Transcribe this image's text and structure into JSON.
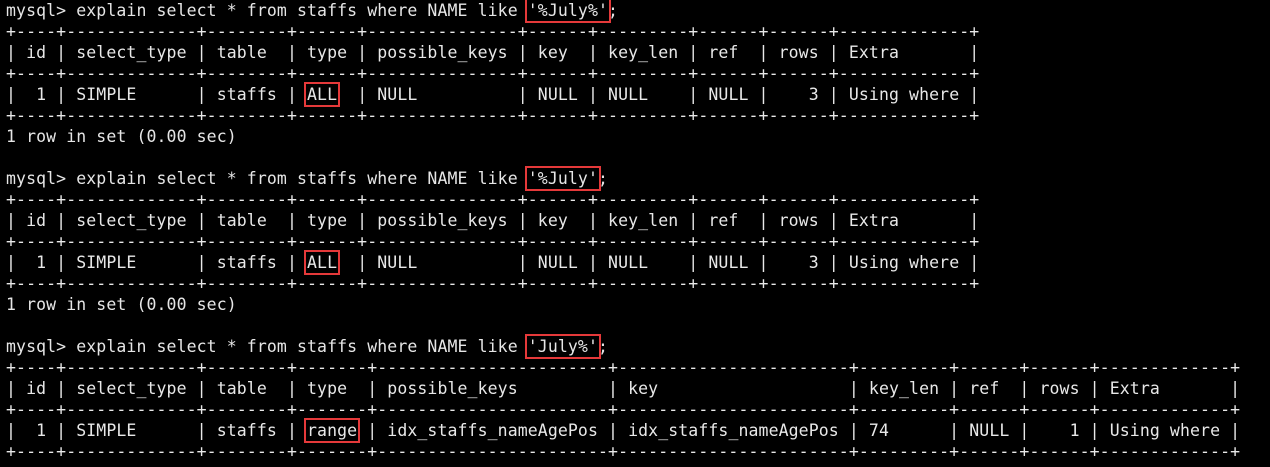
{
  "queries": [
    {
      "prompt_text": "mysql> explain select * from staffs where NAME like ",
      "highlighted_pattern": "'%July%'",
      "terminator": ";",
      "border": "+----+-------------+--------+------+---------------+------+---------+------+------+-------------+",
      "header": "| id | select_type | table  | type | possible_keys | key  | key_len | ref  | rows | Extra       |",
      "row_before_type": "|  1 | SIMPLE      | staffs | ",
      "row_type": "ALL",
      "row_after_type": "  | NULL          | NULL | NULL    | NULL |    3 | Using where |",
      "footer": "1 row in set (0.00 sec)"
    },
    {
      "prompt_text": "mysql> explain select * from staffs where NAME like ",
      "highlighted_pattern": "'%July'",
      "terminator": ";",
      "border": "+----+-------------+--------+------+---------------+------+---------+------+------+-------------+",
      "header": "| id | select_type | table  | type | possible_keys | key  | key_len | ref  | rows | Extra       |",
      "row_before_type": "|  1 | SIMPLE      | staffs | ",
      "row_type": "ALL",
      "row_after_type": "  | NULL          | NULL | NULL    | NULL |    3 | Using where |",
      "footer": "1 row in set (0.00 sec)"
    },
    {
      "prompt_text": "mysql> explain select * from staffs where NAME like ",
      "highlighted_pattern": "'July%'",
      "terminator": ";",
      "border": "+----+-------------+--------+-------+-----------------------+-----------------------+---------+------+------+-------------+",
      "header": "| id | select_type | table  | type  | possible_keys         | key                   | key_len | ref  | rows | Extra       |",
      "row_before_type": "|  1 | SIMPLE      | staffs | ",
      "row_type": "range",
      "row_after_type": " | idx_staffs_nameAgePos | idx_staffs_nameAgePos | 74      | NULL |    1 | Using where |"
    }
  ],
  "colors": {
    "background": "#000000",
    "text": "#e6e6e6",
    "highlight_box": "#e5393a"
  }
}
